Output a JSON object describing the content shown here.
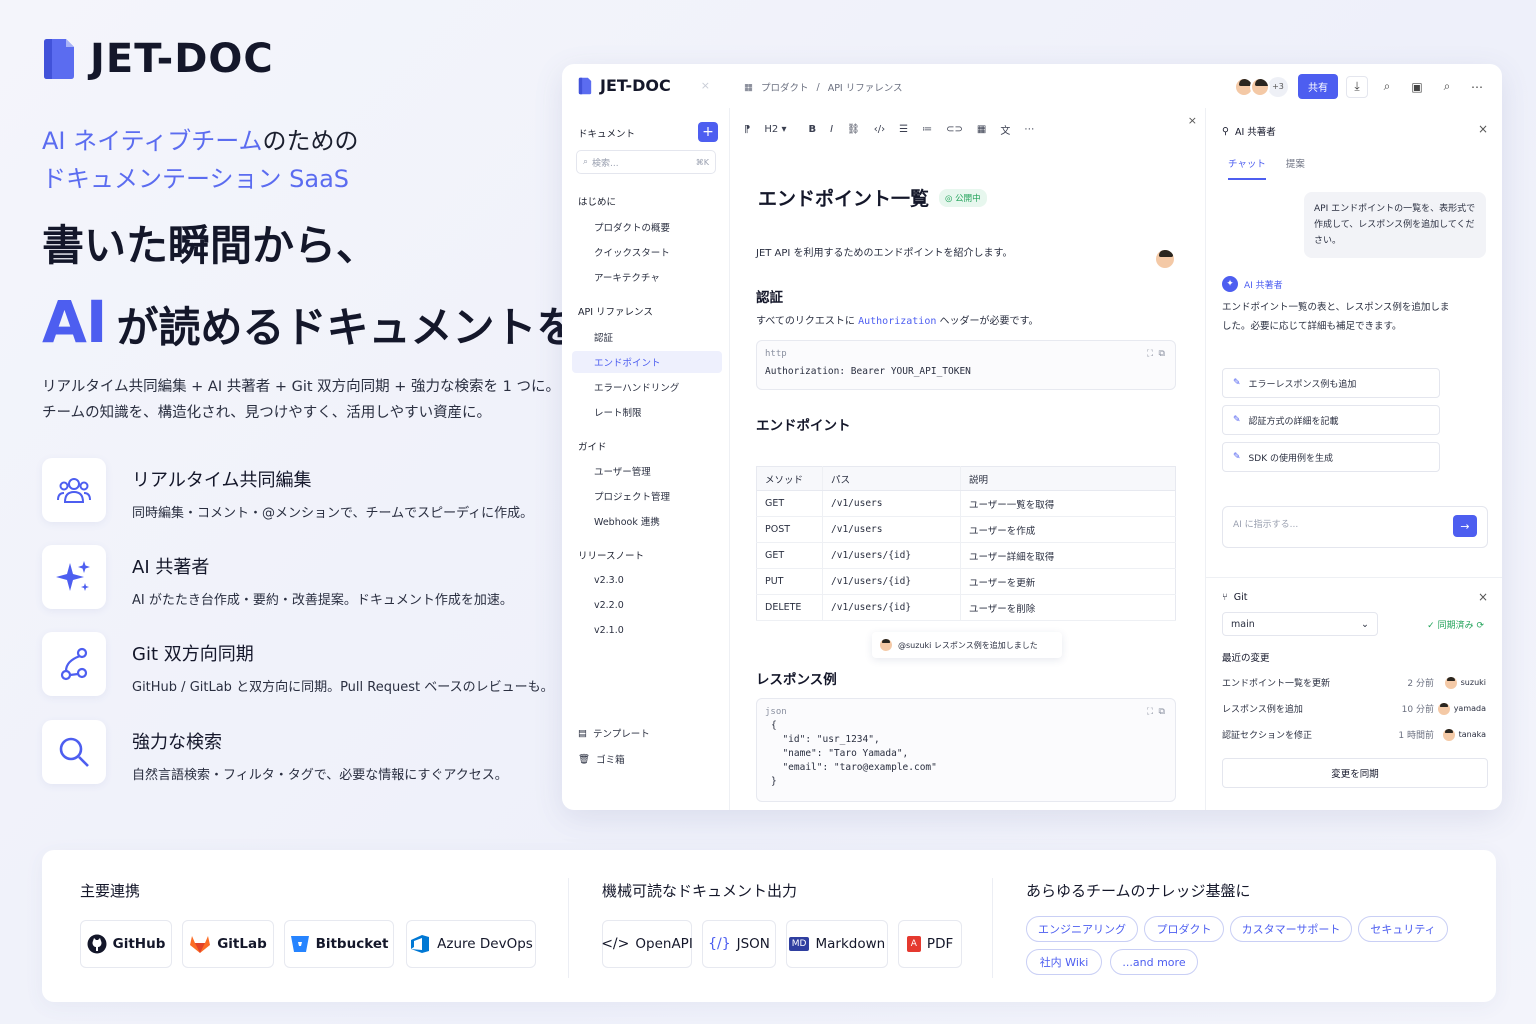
{
  "hero": {
    "brand": "JET-DOC",
    "tagline_hl1": "AI ネイティブチーム",
    "tagline_rest1": "のための",
    "tagline_line2": "ドキュメンテーション SaaS",
    "headline1": "書いた瞬間から、",
    "headline2_ai": "AI",
    "headline2_rest": "が読めるドキュメントを。",
    "desc1": "リアルタイム共同編集 + AI 共著者 + Git 双方向同期 + 強力な検索を 1 つに。",
    "desc2": "チームの知識を、構造化され、見つけやすく、活用しやすい資産に。"
  },
  "features": [
    {
      "title": "リアルタイム共同編集",
      "desc": "同時編集・コメント・@メンションで、チームでスピーディに作成。",
      "icon": "team-icon"
    },
    {
      "title": "AI 共著者",
      "desc": "AI がたたき台作成・要約・改善提案。ドキュメント作成を加速。",
      "icon": "sparkle-icon"
    },
    {
      "title": "Git 双方向同期",
      "desc": "GitHub / GitLab と双方向に同期。Pull Request ベースのレビューも。",
      "icon": "git-branch-icon"
    },
    {
      "title": "強力な検索",
      "desc": "自然言語検索・フィルタ・タグで、必要な情報にすぐアクセス。",
      "icon": "search-icon"
    }
  ],
  "app": {
    "logo": "JET-DOC",
    "breadcrumb": [
      "プロダクト",
      "API リファレンス"
    ],
    "avatar_more": "+3",
    "share": "共有",
    "sidebar": {
      "heading": "ドキュメント",
      "search_placeholder": "検索...",
      "search_kbd": "⌘K",
      "groups": [
        {
          "label": "はじめに",
          "items": [
            "プロダクトの概要",
            "クイックスタート",
            "アーキテクチャ"
          ]
        },
        {
          "label": "API リファレンス",
          "items": [
            "認証",
            "エンドポイント",
            "エラーハンドリング",
            "レート制限"
          ]
        },
        {
          "label": "ガイド",
          "items": [
            "ユーザー管理",
            "プロジェクト管理",
            "Webhook 連携"
          ]
        },
        {
          "label": "リリースノート",
          "items": [
            "v2.3.0",
            "v2.2.0",
            "v2.1.0"
          ]
        }
      ],
      "footer": [
        "テンプレート",
        "ゴミ箱"
      ]
    },
    "editor": {
      "heading_select": "H2",
      "title": "エンドポイント一覧",
      "status": "公開中",
      "intro": "JET API を利用するためのエンドポイントを紹介します。",
      "auth_h": "認証",
      "auth_p1": "すべてのリクエストに ",
      "auth_code": "Authorization",
      "auth_p2": " ヘッダーが必要です。",
      "code1_lang": "http",
      "code1_body": "Authorization: Bearer YOUR_API_TOKEN",
      "endpoints_h": "エンドポイント",
      "table_headers": [
        "メソッド",
        "パス",
        "説明"
      ],
      "table_rows": [
        [
          "GET",
          "/v1/users",
          "ユーザー一覧を取得"
        ],
        [
          "POST",
          "/v1/users",
          "ユーザーを作成"
        ],
        [
          "GET",
          "/v1/users/{id}",
          "ユーザー詳細を取得"
        ],
        [
          "PUT",
          "/v1/users/{id}",
          "ユーザーを更新"
        ],
        [
          "DELETE",
          "/v1/users/{id}",
          "ユーザーを削除"
        ]
      ],
      "toast": "@suzuki レスポンス例を追加しました",
      "resp_h": "レスポンス例",
      "code2_lang": "json",
      "code2_body": "{\n  \"id\": \"usr_1234\",\n  \"name\": \"Taro Yamada\",\n  \"email\": \"taro@example.com\"\n}"
    },
    "ai": {
      "title": "AI 共著者",
      "tabs": [
        "チャット",
        "提案"
      ],
      "user_msg": "API エンドポイントの一覧を、表形式で作成して、レスポンス例を追加してください。",
      "ai_label": "AI 共著者",
      "ai_msg": "エンドポイント一覧の表と、レスポンス例を追加しました。必要に応じて詳細も補足できます。",
      "suggestions": [
        "エラーレスポンス例も追加",
        "認証方式の詳細を記載",
        "SDK の使用例を生成"
      ],
      "prompt_placeholder": "AI に指示する..."
    },
    "git": {
      "title": "Git",
      "branch": "main",
      "status": "同期済み",
      "recent": "最近の変更",
      "changes": [
        {
          "msg": "エンドポイント一覧を更新",
          "time": "2 分前",
          "user": "suzuki"
        },
        {
          "msg": "レスポンス例を追加",
          "time": "10 分前",
          "user": "yamada"
        },
        {
          "msg": "認証セクションを修正",
          "time": "1 時間前",
          "user": "tanaka"
        }
      ],
      "sync_button": "変更を同期"
    }
  },
  "bottom": {
    "integrations_h": "主要連携",
    "integrations": [
      "GitHub",
      "GitLab",
      "Bitbucket",
      "Azure DevOps"
    ],
    "outputs_h": "機械可読なドキュメント出力",
    "outputs": [
      "OpenAPI",
      "JSON",
      "Markdown",
      "PDF"
    ],
    "teams_h": "あらゆるチームのナレッジ基盤に",
    "teams": [
      "エンジニアリング",
      "プロダクト",
      "カスタマーサポート",
      "セキュリティ",
      "社内 Wiki",
      "...and more"
    ]
  },
  "colors": {
    "accent": "#4d5ef0",
    "success": "#22a35a",
    "text": "#14172a"
  }
}
